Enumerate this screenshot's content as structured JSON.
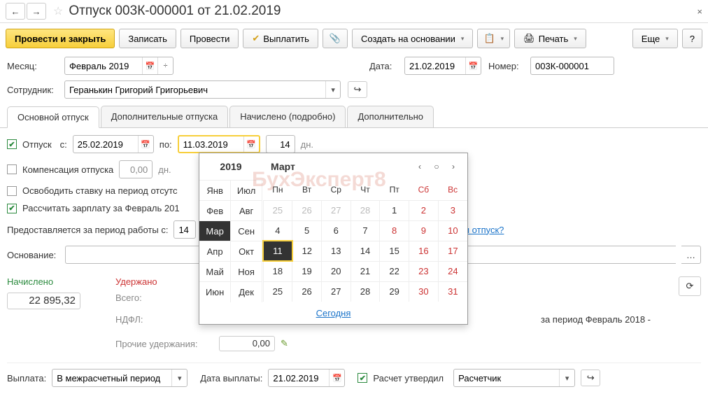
{
  "header": {
    "title": "Отпуск 003К-000001 от 21.02.2019"
  },
  "toolbar": {
    "post_close": "Провести и закрыть",
    "save": "Записать",
    "post": "Провести",
    "pay": "Выплатить",
    "create_based": "Создать на основании",
    "print": "Печать",
    "more": "Еще"
  },
  "month_field": {
    "label": "Месяц:",
    "value": "Февраль 2019"
  },
  "date_field": {
    "label": "Дата:",
    "value": "21.02.2019"
  },
  "number_field": {
    "label": "Номер:",
    "value": "003К-000001"
  },
  "employee_field": {
    "label": "Сотрудник:",
    "value": "Геранькин Григорий Григорьевич"
  },
  "tabs": [
    "Основной отпуск",
    "Дополнительные отпуска",
    "Начислено (подробно)",
    "Дополнительно"
  ],
  "vacation": {
    "chk": "Отпуск",
    "from_l": "с:",
    "from_v": "25.02.2019",
    "to_l": "по:",
    "to_v": "11.03.2019",
    "days": "14",
    "days_l": "дн."
  },
  "comp": {
    "label": "Компенсация отпуска",
    "value": "0,00",
    "unit": "дн."
  },
  "release": "Освободить ставку на период отсутс",
  "calc": "Рассчитать зарплату за Февраль 201",
  "period": {
    "label": "Предоставляется за период работы с:",
    "value": "14",
    "used_link": "зовал отпуск?"
  },
  "basis_label": "Основание:",
  "totals": {
    "accrued_l": "Начислено",
    "accrued_v": "22 895,32",
    "withheld_l": "Удержано",
    "total_l": "Всего:",
    "ndfl_l": "НДФЛ:",
    "other_l": "Прочие удержания:",
    "other_v": "0,00"
  },
  "period_note": "за период Февраль 2018 -",
  "payout": {
    "label": "Выплата:",
    "value": "В межрасчетный период",
    "date_l": "Дата выплаты:",
    "date_v": "21.02.2019",
    "approved": "Расчет утвердил",
    "approver": "Расчетчик"
  },
  "cal": {
    "year": "2019",
    "month": "Март",
    "months": [
      [
        "Янв",
        "Июл"
      ],
      [
        "Фев",
        "Авг"
      ],
      [
        "Мар",
        "Сен"
      ],
      [
        "Апр",
        "Окт"
      ],
      [
        "Май",
        "Ноя"
      ],
      [
        "Июн",
        "Дек"
      ]
    ],
    "dow": [
      "Пн",
      "Вт",
      "Ср",
      "Чт",
      "Пт",
      "Сб",
      "Вс"
    ],
    "weeks": [
      [
        {
          "n": 25,
          "o": true
        },
        {
          "n": 26,
          "o": true
        },
        {
          "n": 27,
          "o": true
        },
        {
          "n": 28,
          "o": true
        },
        {
          "n": 1
        },
        {
          "n": 2,
          "w": true
        },
        {
          "n": 3,
          "w": true
        }
      ],
      [
        {
          "n": 4
        },
        {
          "n": 5
        },
        {
          "n": 6
        },
        {
          "n": 7
        },
        {
          "n": 8,
          "w": true
        },
        {
          "n": 9,
          "w": true
        },
        {
          "n": 10,
          "w": true
        }
      ],
      [
        {
          "n": 11,
          "s": true
        },
        {
          "n": 12
        },
        {
          "n": 13
        },
        {
          "n": 14
        },
        {
          "n": 15
        },
        {
          "n": 16,
          "w": true
        },
        {
          "n": 17,
          "w": true
        }
      ],
      [
        {
          "n": 18
        },
        {
          "n": 19
        },
        {
          "n": 20
        },
        {
          "n": 21
        },
        {
          "n": 22
        },
        {
          "n": 23,
          "w": true
        },
        {
          "n": 24,
          "w": true
        }
      ],
      [
        {
          "n": 25
        },
        {
          "n": 26
        },
        {
          "n": 27
        },
        {
          "n": 28
        },
        {
          "n": 29
        },
        {
          "n": 30,
          "w": true
        },
        {
          "n": 31,
          "w": true
        }
      ]
    ],
    "today": "Сегодня"
  },
  "watermark": "БухЭксперт8"
}
